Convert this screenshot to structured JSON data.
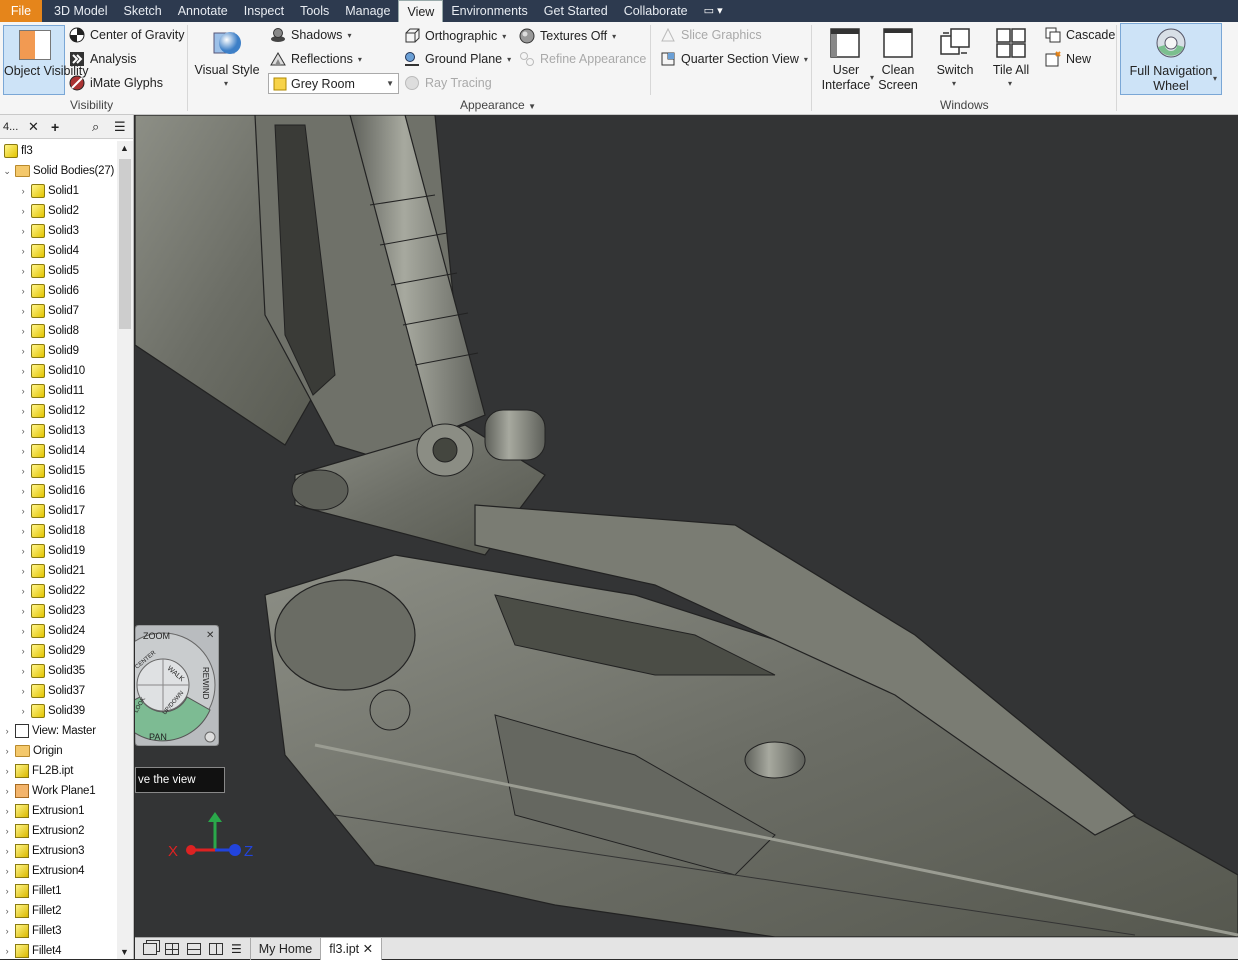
{
  "menubar": {
    "tabs": [
      {
        "label": "File"
      },
      {
        "label": "3D Model"
      },
      {
        "label": "Sketch"
      },
      {
        "label": "Annotate"
      },
      {
        "label": "Inspect"
      },
      {
        "label": "Tools"
      },
      {
        "label": "Manage"
      },
      {
        "label": "View"
      },
      {
        "label": "Environments"
      },
      {
        "label": "Get Started"
      },
      {
        "label": "Collaborate"
      }
    ],
    "active_tab": "View",
    "extra_icon": "panel-dropdown-icon"
  },
  "ribbon": {
    "visibility": {
      "object_visibility": "Object Visibility",
      "center_of_gravity": "Center of Gravity",
      "analysis": "Analysis",
      "imate_glyphs": "iMate Glyphs",
      "group_label": "Visibility"
    },
    "appearance": {
      "visual_style": "Visual Style",
      "shadows": "Shadows",
      "reflections": "Reflections",
      "lighting_style": "Grey Room",
      "orthographic": "Orthographic",
      "ground_plane": "Ground Plane",
      "ray_tracing": "Ray Tracing",
      "textures_off": "Textures Off",
      "refine_appearance": "Refine Appearance",
      "slice_graphics": "Slice Graphics",
      "quarter_section_view": "Quarter Section View",
      "group_label": "Appearance"
    },
    "windows": {
      "user_interface": "User Interface",
      "clean_screen": "Clean Screen",
      "switch": "Switch",
      "tile_all": "Tile All",
      "cascade": "Cascade",
      "new": "New",
      "group_label": "Windows"
    },
    "navigate": {
      "full_navigation_wheel": "Full Navigation Wheel"
    }
  },
  "browser": {
    "header_tab": "4...",
    "root": "fl3",
    "solid_bodies": "Solid Bodies(27)",
    "solids": [
      "Solid1",
      "Solid2",
      "Solid3",
      "Solid4",
      "Solid5",
      "Solid6",
      "Solid7",
      "Solid8",
      "Solid9",
      "Solid10",
      "Solid11",
      "Solid12",
      "Solid13",
      "Solid14",
      "Solid15",
      "Solid16",
      "Solid17",
      "Solid18",
      "Solid19",
      "Solid21",
      "Solid22",
      "Solid23",
      "Solid24",
      "Solid29",
      "Solid35",
      "Solid37",
      "Solid39"
    ],
    "items": [
      {
        "label": "View: Master",
        "icon": "view-icon"
      },
      {
        "label": "Origin",
        "icon": "folder-icon"
      },
      {
        "label": "FL2B.ipt",
        "icon": "derived-part-icon"
      },
      {
        "label": "Work Plane1",
        "icon": "work-plane-icon"
      },
      {
        "label": "Extrusion1",
        "icon": "extrusion-icon"
      },
      {
        "label": "Extrusion2",
        "icon": "extrusion-icon"
      },
      {
        "label": "Extrusion3",
        "icon": "extrusion-icon"
      },
      {
        "label": "Extrusion4",
        "icon": "extrusion-icon"
      },
      {
        "label": "Fillet1",
        "icon": "fillet-icon"
      },
      {
        "label": "Fillet2",
        "icon": "fillet-icon"
      },
      {
        "label": "Fillet3",
        "icon": "fillet-icon"
      },
      {
        "label": "Fillet4",
        "icon": "fillet-icon"
      }
    ]
  },
  "navwheel": {
    "zoom": "ZOOM",
    "center": "CENTER",
    "walk": "WALK",
    "rewind": "REWIND",
    "updown": "UP/DOWN",
    "look": "LOOK",
    "pan": "PAN"
  },
  "tooltip": "ve the view",
  "triad": {
    "x": "X",
    "y": "Y",
    "z": "Z"
  },
  "bottombar": {
    "home": "My Home",
    "doc": "fl3.ipt"
  }
}
